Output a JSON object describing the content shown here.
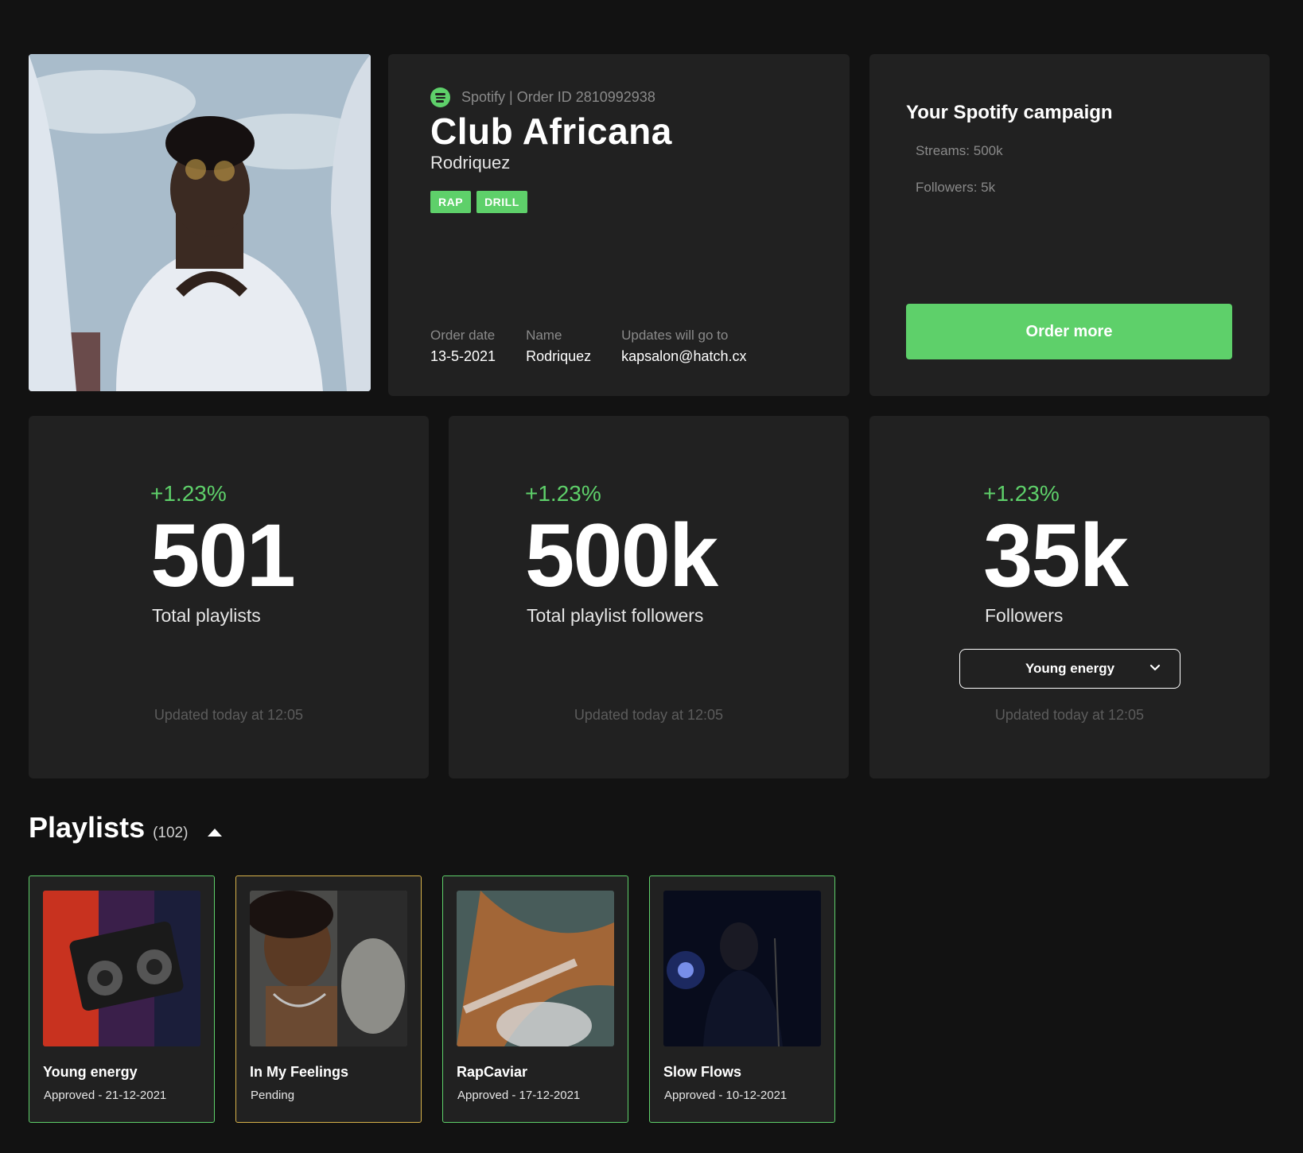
{
  "order": {
    "meta": "Spotify | Order ID 2810992938",
    "title": "Club Africana",
    "artist": "Rodriquez",
    "tags": [
      "RAP",
      "DRILL"
    ],
    "info": [
      {
        "label": "Order date",
        "value": "13-5-2021"
      },
      {
        "label": "Name",
        "value": "Rodriquez"
      },
      {
        "label": "Updates will go to",
        "value": "kapsalon@hatch.cx"
      }
    ]
  },
  "campaign": {
    "title": "Your Spotify campaign",
    "streams": "Streams:  500k",
    "followers": "Followers: 5k",
    "button": "Order more"
  },
  "stats": [
    {
      "change": "+1.23%",
      "value": "501",
      "label": "Total playlists",
      "updated": "Updated today at 12:05"
    },
    {
      "change": "+1.23%",
      "value": "500k",
      "label": "Total playlist followers",
      "updated": "Updated today at 12:05"
    },
    {
      "change": "+1.23%",
      "value": "35k",
      "label": "Followers",
      "updated": "Updated today at 12:05",
      "select": "Young energy"
    }
  ],
  "playlists": {
    "title": "Playlists",
    "count": "(102)",
    "items": [
      {
        "name": "Young energy",
        "status": "Approved - 21-12-2021"
      },
      {
        "name": "In My Feelings",
        "status": "Pending"
      },
      {
        "name": "RapCaviar",
        "status": "Approved - 17-12-2021"
      },
      {
        "name": "Slow Flows",
        "status": "Approved - 10-12-2021"
      }
    ]
  },
  "colors": {
    "accent": "#5ed06a",
    "pending": "#d8b24a",
    "card": "#212121",
    "background": "#121212"
  }
}
